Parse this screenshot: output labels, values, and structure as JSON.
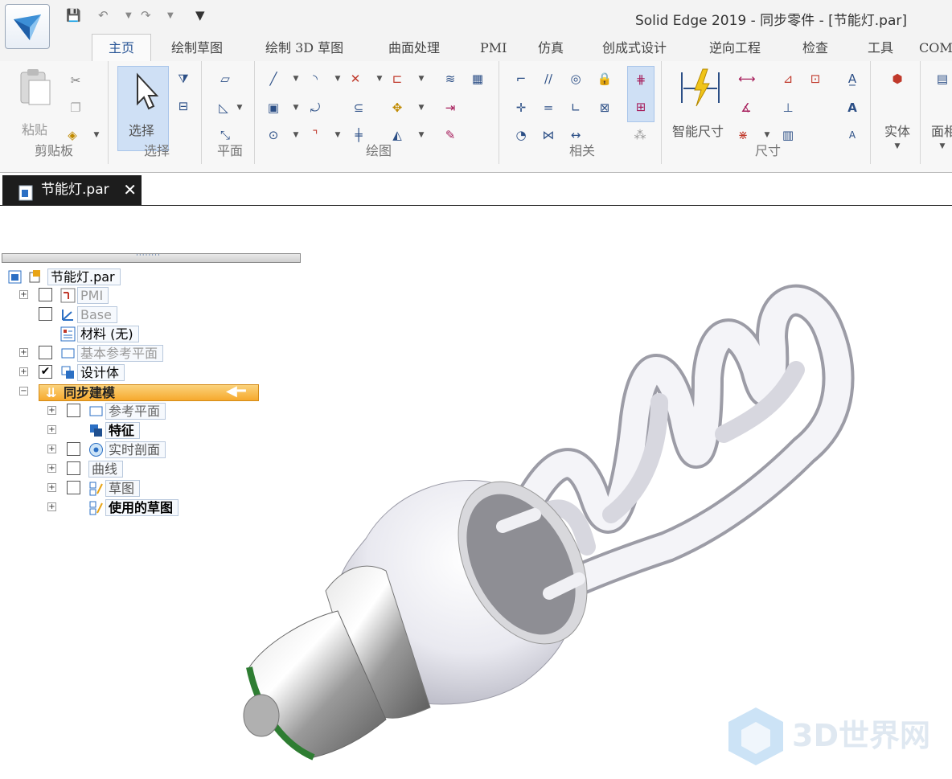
{
  "window": {
    "title": "Solid Edge 2019 - 同步零件 - [节能灯.par]"
  },
  "tabs": [
    "主页",
    "绘制草图",
    "绘制 3D 草图",
    "曲面处理",
    "PMI",
    "仿真",
    "创成式设计",
    "逆向工程",
    "检查",
    "工具",
    "COMSO"
  ],
  "ribbon": {
    "clipboard": {
      "label": "剪贴板",
      "paste": "粘贴"
    },
    "select": {
      "label": "选择",
      "button": "选择"
    },
    "plane": {
      "label": "平面"
    },
    "draw": {
      "label": "绘图"
    },
    "relate": {
      "label": "相关"
    },
    "dimension": {
      "label": "尺寸",
      "smart": "智能尺寸"
    },
    "solid": {
      "label": "实体"
    },
    "face": {
      "label": "面相"
    }
  },
  "document_tab": {
    "label": "节能灯.par"
  },
  "tree": {
    "root": "节能灯.par",
    "pmi": "PMI",
    "base": "Base",
    "material": "材料 (无)",
    "ref_planes_base": "基本参考平面",
    "design_body": "设计体",
    "sync": "同步建模",
    "ref_planes": "参考平面",
    "features": "特征",
    "live_sections": "实时剖面",
    "curves": "曲线",
    "sketches": "草图",
    "used_sketches": "使用的草图"
  },
  "watermark": "3D世界网",
  "colors": {
    "accent": "#2b5797",
    "highlight": "#f6a92e",
    "base_ring": "#2e7d32"
  }
}
